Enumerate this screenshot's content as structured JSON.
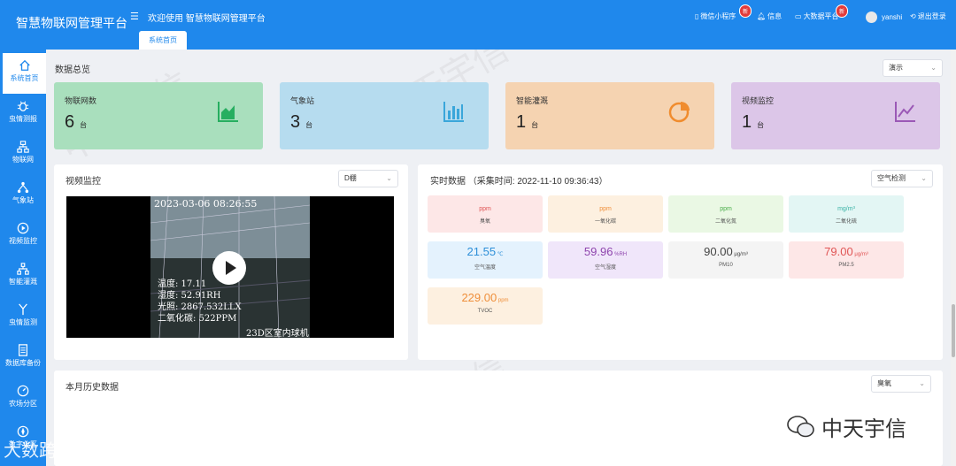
{
  "app": {
    "title": "智慧物联网管理平台",
    "welcome": "欢迎使用 智慧物联网管理平台",
    "active_tab": "系统首页"
  },
  "top_right": {
    "mini_program": "微信小程序",
    "mini_badge": "新",
    "messages": "信息",
    "bigscreen": "大数据平台",
    "bigscreen_badge": "新",
    "user": "yanshi",
    "logout": "退出登录"
  },
  "sidebar": {
    "items": [
      {
        "label": "系统首页",
        "icon": "home-icon"
      },
      {
        "label": "虫情测报",
        "icon": "bug-icon"
      },
      {
        "label": "物联网",
        "icon": "iot-icon"
      },
      {
        "label": "气象站",
        "icon": "weather-icon"
      },
      {
        "label": "视频监控",
        "icon": "play-icon"
      },
      {
        "label": "智能灌溉",
        "icon": "irrigation-icon"
      },
      {
        "label": "虫情监测",
        "icon": "antenna-icon"
      },
      {
        "label": "数据库备份",
        "icon": "database-icon"
      },
      {
        "label": "农场分区",
        "icon": "dashboard-icon"
      },
      {
        "label": "数字化区",
        "icon": "compass-icon"
      }
    ]
  },
  "overview": {
    "title": "数据总览",
    "select": "演示",
    "cards": [
      {
        "label": "物联网数",
        "value": "6",
        "unit": "台",
        "bg": "#a9dfbd",
        "icon_color": "#27ae60",
        "icon": "area-chart-icon"
      },
      {
        "label": "气象站",
        "value": "3",
        "unit": "台",
        "bg": "#b6dcef",
        "icon_color": "#3aa6da",
        "icon": "bar-chart-icon"
      },
      {
        "label": "智能灌溉",
        "value": "1",
        "unit": "台",
        "bg": "#f5d3b1",
        "icon_color": "#f08c2e",
        "icon": "pie-chart-icon"
      },
      {
        "label": "视频监控",
        "value": "1",
        "unit": "台",
        "bg": "#dcc6e8",
        "icon_color": "#9b59b6",
        "icon": "line-chart-icon"
      }
    ]
  },
  "video": {
    "title": "视频监控",
    "select": "D棚",
    "timestamp": "2023-03-06 08:26:55",
    "lines": [
      "温度: 17.11",
      "湿度: 52.91RH",
      "光照: 2867.532LLX",
      "二氧化碳: 522PPM"
    ],
    "caption": "23D区室内球机"
  },
  "realtime": {
    "title": "实时数据",
    "collect": "（采集时间: 2022-11-10 09:36:43）",
    "select": "空气检测",
    "tiles": [
      {
        "value": "",
        "unit": "ppm",
        "label": "臭氧",
        "bg": "#fde7e7",
        "color": "#e05555"
      },
      {
        "value": "",
        "unit": "ppm",
        "label": "一氧化碳",
        "bg": "#fdf0e0",
        "color": "#ef8f3b"
      },
      {
        "value": "",
        "unit": "ppm",
        "label": "二氧化氮",
        "bg": "#eaf8e4",
        "color": "#4cae4c"
      },
      {
        "value": "",
        "unit": "mg/m³",
        "label": "二氧化硫",
        "bg": "#e3f6f4",
        "color": "#3bb3a6"
      },
      {
        "value": "21.55",
        "unit": "℃",
        "label": "空气温度",
        "bg": "#e4f2fd",
        "color": "#2d8fd8"
      },
      {
        "value": "59.96",
        "unit": "%RH",
        "label": "空气湿度",
        "bg": "#f0e6fa",
        "color": "#8e44ad"
      },
      {
        "value": "90.00",
        "unit": "μg/m³",
        "label": "PM10",
        "bg": "#f4f4f4",
        "color": "#444"
      },
      {
        "value": "79.00",
        "unit": "μg/m³",
        "label": "PM2.5",
        "bg": "#fde7e7",
        "color": "#e05555"
      },
      {
        "value": "229.00",
        "unit": "ppm",
        "label": "TVOC",
        "bg": "#fdf0e0",
        "color": "#ef8f3b"
      }
    ]
  },
  "history": {
    "title": "本月历史数据",
    "select": "臭氧"
  },
  "watermarks": {
    "bottom_left": "大数跨境",
    "bottom_right": "中天宇信",
    "pattern": "中天宇信"
  }
}
